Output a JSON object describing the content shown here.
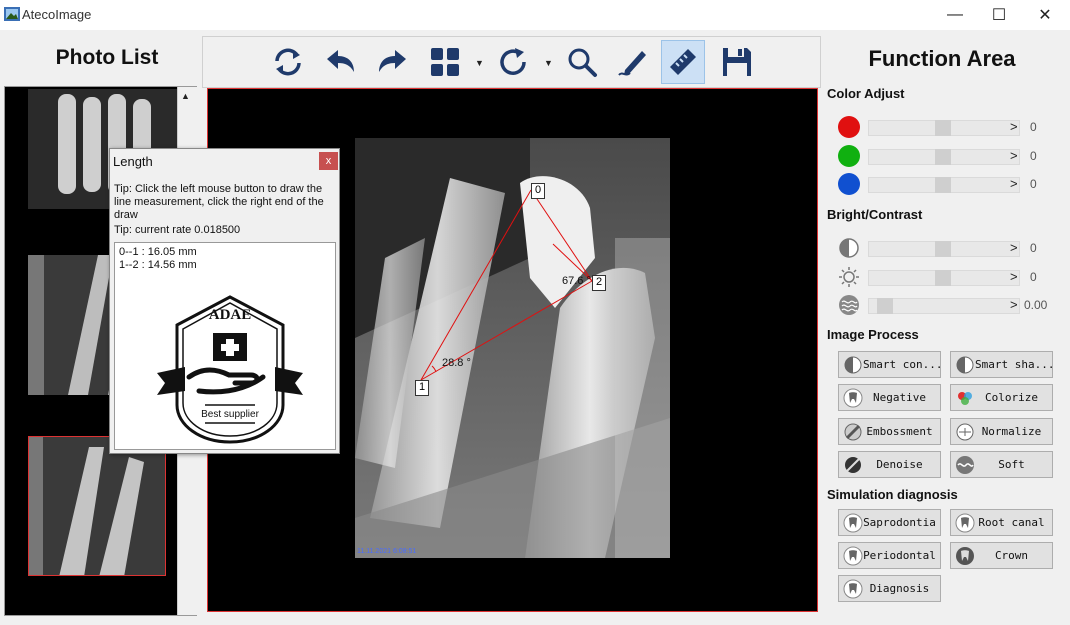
{
  "window": {
    "title": "AtecoImage",
    "min": "—",
    "max": "☐",
    "close": "✕"
  },
  "photo_list": {
    "title": "Photo List",
    "scroll_up": "▲"
  },
  "toolbar": {
    "tools": [
      "refresh-icon",
      "undo-icon",
      "redo-icon",
      "layout-grid-icon",
      "rotate-icon",
      "zoom-icon",
      "pen-icon",
      "ruler-icon",
      "save-icon"
    ],
    "active": "ruler-icon",
    "dropdown_glyph": "▼"
  },
  "viewer": {
    "labels": {
      "p0": "0",
      "p1": "1",
      "p2": "2",
      "angle1": "28.8 °",
      "angle2": "67.6 °"
    },
    "watermark": "11.11.2021 6:08:51"
  },
  "function_area": {
    "title": "Function Area",
    "color_adjust": {
      "title": "Color Adjust",
      "red": "0",
      "green": "0",
      "blue": "0",
      "colors": {
        "red": "#e01010",
        "green": "#10b010",
        "blue": "#1050d0"
      }
    },
    "bright_contrast": {
      "title": "Bright/Contrast",
      "v1": "0",
      "v2": "0",
      "v3": "0.00"
    },
    "image_process": {
      "title": "Image Process",
      "buttons": [
        "Smart con...",
        "Smart sha...",
        "Negative",
        "Colorize",
        "Embossment",
        "Normalize",
        "Denoise",
        "Soft"
      ]
    },
    "simulation": {
      "title": "Simulation diagnosis",
      "buttons": [
        "Saprodontia",
        "Root canal",
        "Periodontal",
        "Crown",
        "Diagnosis"
      ]
    },
    "arrow_left": "<",
    "arrow_right": ">"
  },
  "dialog": {
    "title": "Length",
    "close": "x",
    "tip1": "Tip: Click the left mouse button to draw the line measurement, click the right end of the draw",
    "tip2": "Tip: current rate 0.018500",
    "measurements": [
      "0--1 : 16.05 mm",
      "1--2 : 14.56 mm"
    ],
    "logo_text": "ADAE",
    "logo_sub": "Best supplier"
  }
}
